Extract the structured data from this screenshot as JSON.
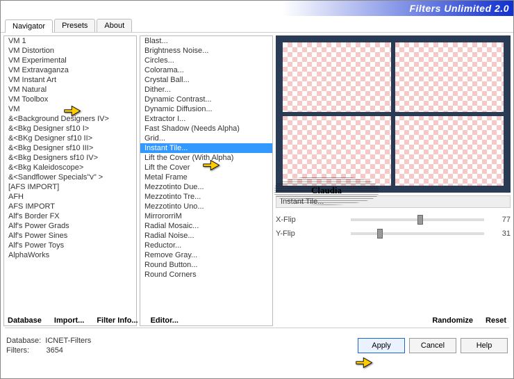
{
  "title": "Filters Unlimited 2.0",
  "tabs": [
    "Navigator",
    "Presets",
    "About"
  ],
  "active_tab": 0,
  "categories": [
    "VM 1",
    "VM Distortion",
    "VM Experimental",
    "VM Extravaganza",
    "VM Instant Art",
    "VM Natural",
    "VM Toolbox",
    "VM",
    "&<Background Designers IV>",
    "&<Bkg Designer sf10 I>",
    "&<BKg Designer sf10 II>",
    "&<Bkg Designer sf10 III>",
    "&<Bkg Designers sf10 IV>",
    "&<Bkg Kaleidoscope>",
    "&<Sandflower Specials\"v\" >",
    "[AFS IMPORT]",
    "AFH",
    "AFS IMPORT",
    "Alf's Border FX",
    "Alf's Power Grads",
    "Alf's Power Sines",
    "Alf's Power Toys",
    "AlphaWorks"
  ],
  "selected_category_index": 6,
  "filters": [
    "Blast...",
    "Brightness Noise...",
    "Circles...",
    "Colorama...",
    "Crystal Ball...",
    "Dither...",
    "Dynamic Contrast...",
    "Dynamic Diffusion...",
    "Extractor I...",
    "Fast Shadow (Needs Alpha)",
    "Grid...",
    "Instant Tile...",
    "Lift the Cover (With Alpha)",
    "Lift the Cover",
    "Metal Frame",
    "Mezzotinto Due...",
    "Mezzotinto Tre...",
    "Mezzotinto Uno...",
    "MirrororriM",
    "Radial Mosaic...",
    "Radial Noise...",
    "Reductor...",
    "Remove Gray...",
    "Round Button...",
    "Round Corners"
  ],
  "selected_filter_index": 11,
  "current_filter_name": "Instant Tile...",
  "params": [
    {
      "label": "X-Flip",
      "value": 77,
      "pos": 50
    },
    {
      "label": "Y-Flip",
      "value": 31,
      "pos": 20
    }
  ],
  "link_buttons_left": [
    "Database",
    "Import...",
    "Filter Info...",
    "Editor..."
  ],
  "link_buttons_right": [
    "Randomize",
    "Reset"
  ],
  "footer": {
    "db_label": "Database:",
    "db_value": "ICNET-Filters",
    "filters_label": "Filters:",
    "filters_value": "3654"
  },
  "buttons": {
    "apply": "Apply",
    "cancel": "Cancel",
    "help": "Help"
  },
  "watermark": "Claudia"
}
